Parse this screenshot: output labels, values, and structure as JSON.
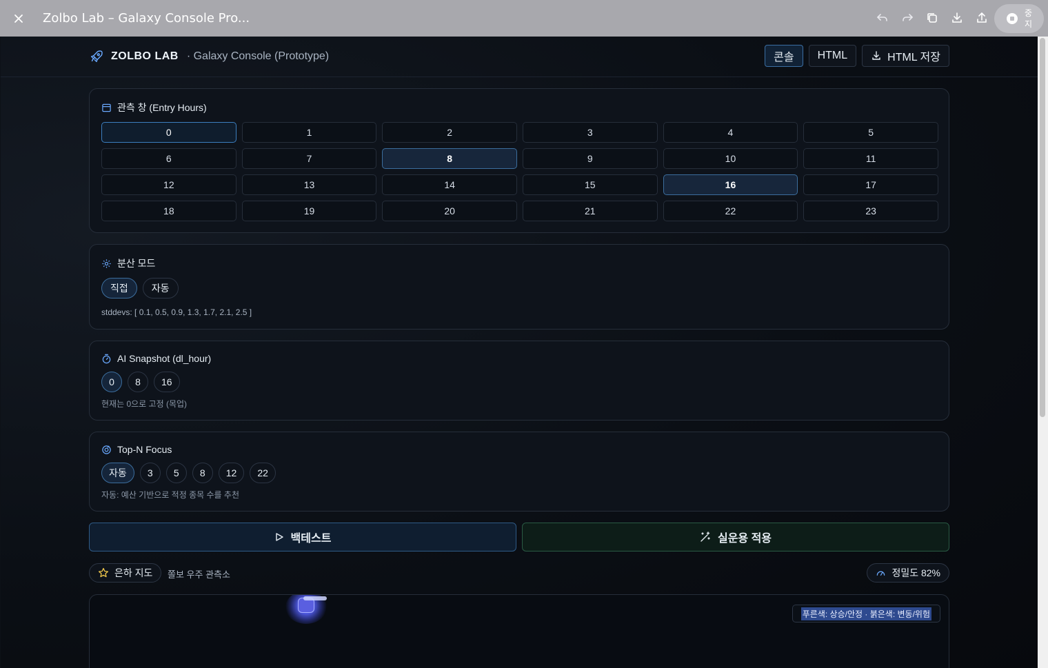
{
  "window": {
    "title": "Zolbo Lab – Galaxy Console Pro...",
    "stop_label": "중지"
  },
  "header": {
    "brand": "ZOLBO LAB",
    "subtitle": "· Galaxy Console (Prototype)",
    "buttons": {
      "console": "콘솔",
      "html": "HTML",
      "save_html": "HTML 저장"
    }
  },
  "entry_hours": {
    "title": "관측 창 (Entry Hours)",
    "hours": [
      "0",
      "1",
      "2",
      "3",
      "4",
      "5",
      "6",
      "7",
      "8",
      "9",
      "10",
      "11",
      "12",
      "13",
      "14",
      "15",
      "16",
      "17",
      "18",
      "19",
      "20",
      "21",
      "22",
      "23"
    ],
    "selected": [
      "0",
      "8",
      "16"
    ]
  },
  "dispersion": {
    "title": "분산 모드",
    "options": [
      "직접",
      "자동"
    ],
    "selected": "직접",
    "note": "stddevs: [ 0.1, 0.5, 0.9, 1.3, 1.7, 2.1, 2.5 ]"
  },
  "ai_snapshot": {
    "title": "AI Snapshot (dl_hour)",
    "options": [
      "0",
      "8",
      "16"
    ],
    "selected": "0",
    "note": "현재는 0으로 고정 (목업)"
  },
  "top_n": {
    "title": "Top-N Focus",
    "options": [
      "자동",
      "3",
      "5",
      "8",
      "12",
      "22"
    ],
    "selected": "자동",
    "note": "자동: 예산 기반으로 적정 종목 수를 추천"
  },
  "actions": {
    "backtest": "백테스트",
    "live": "실운용 적용"
  },
  "galaxy": {
    "map_label": "은하 지도",
    "observatory": "쫄보 우주 관측소",
    "precision": "정밀도 82%",
    "legend": "푸른색: 상승/안정 · 붉은색: 변동/위험"
  },
  "colors": {
    "accent": "#3c6e9e",
    "live_accent": "#2a5a44",
    "star": "#f2c94c"
  }
}
